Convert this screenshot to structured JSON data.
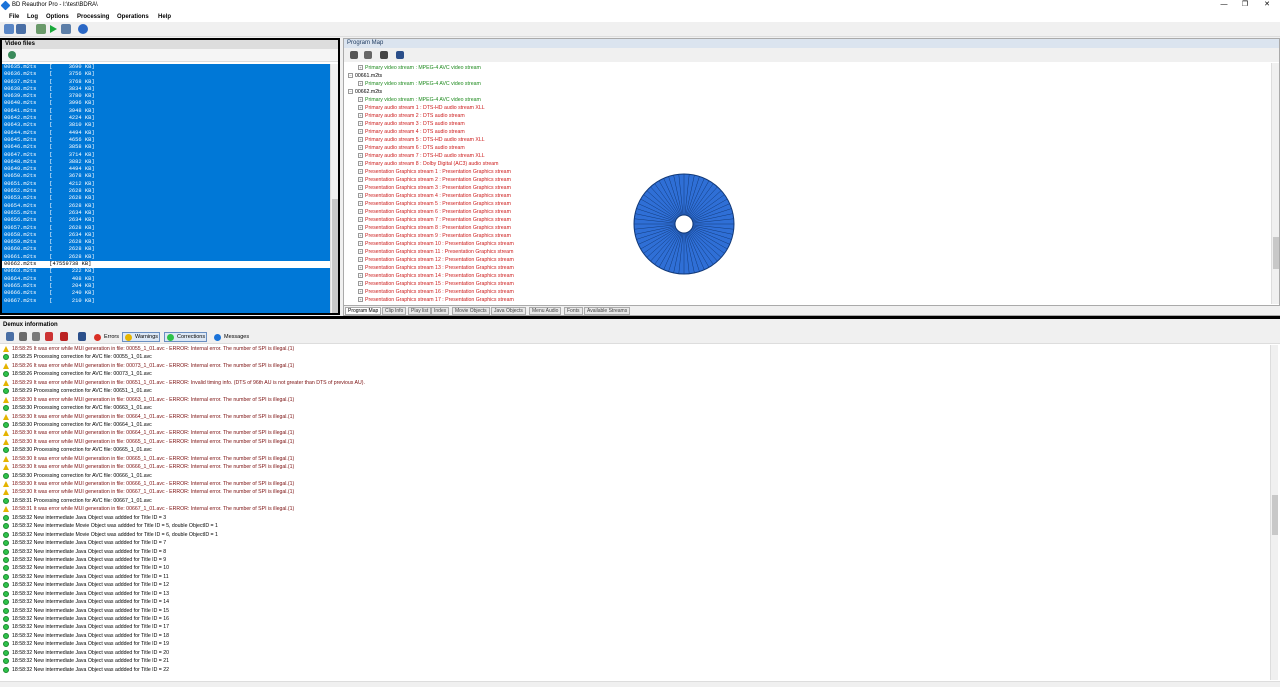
{
  "window": {
    "title": "BD Reauthor Pro - I:\\test\\BDRA\\",
    "min": "—",
    "max": "❐",
    "close": "✕"
  },
  "menu": [
    "File",
    "Log",
    "Options",
    "Processing",
    "Operations",
    "Help"
  ],
  "video_files": {
    "title": "Video files",
    "rows": [
      "00635.m2ts    [     3690 KB]",
      "00636.m2ts    [     3756 KB]",
      "00637.m2ts    [     3768 KB]",
      "00638.m2ts    [     3834 KB]",
      "00639.m2ts    [     3780 KB]",
      "00640.m2ts    [     3996 KB]",
      "00641.m2ts    [     3948 KB]",
      "00642.m2ts    [     4224 KB]",
      "00643.m2ts    [     3810 KB]",
      "00644.m2ts    [     4494 KB]",
      "00645.m2ts    [     4656 KB]",
      "00646.m2ts    [     3858 KB]",
      "00647.m2ts    [     3714 KB]",
      "00648.m2ts    [     3882 KB]",
      "00649.m2ts    [     4494 KB]",
      "00650.m2ts    [     3678 KB]",
      "00651.m2ts    [     4212 KB]",
      "00652.m2ts    [     2628 KB]",
      "00653.m2ts    [     2628 KB]",
      "00654.m2ts    [     2628 KB]",
      "00655.m2ts    [     2634 KB]",
      "00656.m2ts    [     2634 KB]",
      "00657.m2ts    [     2628 KB]",
      "00658.m2ts    [     2634 KB]",
      "00659.m2ts    [     2628 KB]",
      "00660.m2ts    [     2628 KB]",
      "00661.m2ts    [     2628 KB]",
      "00662.m2ts    [47559738 KB]",
      "00663.m2ts    [      222 KB]",
      "00664.m2ts    [      408 KB]",
      "00665.m2ts    [      204 KB]",
      "00666.m2ts    [      240 KB]",
      "00667.m2ts    [      210 KB]"
    ],
    "selected_index": 27
  },
  "program_map": {
    "title": "Program Map",
    "tree": [
      {
        "indent": 1,
        "text": "Primary video stream : MPEG-4 AVC video stream",
        "color": "green",
        "exp": "+"
      },
      {
        "indent": 0,
        "text": "00661.m2ts",
        "color": "black",
        "exp": "−"
      },
      {
        "indent": 1,
        "text": "Primary video stream : MPEG-4 AVC video stream",
        "color": "green",
        "exp": "+"
      },
      {
        "indent": 0,
        "text": "00662.m2ts",
        "color": "black",
        "exp": "−"
      },
      {
        "indent": 1,
        "text": "Primary video stream : MPEG-4 AVC video stream",
        "color": "green",
        "exp": "+"
      },
      {
        "indent": 1,
        "text": "Primary audio stream  1 : DTS-HD audio stream XLL",
        "color": "red",
        "exp": "+"
      },
      {
        "indent": 1,
        "text": "Primary audio stream  2 : DTS audio stream",
        "color": "red",
        "exp": "+"
      },
      {
        "indent": 1,
        "text": "Primary audio stream  3 : DTS audio stream",
        "color": "red",
        "exp": "+"
      },
      {
        "indent": 1,
        "text": "Primary audio stream  4 : DTS audio stream",
        "color": "red",
        "exp": "+"
      },
      {
        "indent": 1,
        "text": "Primary audio stream  5 : DTS-HD audio stream XLL",
        "color": "red",
        "exp": "+"
      },
      {
        "indent": 1,
        "text": "Primary audio stream  6 : DTS audio stream",
        "color": "red",
        "exp": "+"
      },
      {
        "indent": 1,
        "text": "Primary audio stream  7 : DTS-HD audio stream XLL",
        "color": "red",
        "exp": "+"
      },
      {
        "indent": 1,
        "text": "Primary audio stream  8 : Dolby Digital (AC3) audio stream",
        "color": "red",
        "exp": "+"
      },
      {
        "indent": 1,
        "text": "Presentation Graphics stream  1 : Presentation Graphics stream",
        "color": "red",
        "exp": "+"
      },
      {
        "indent": 1,
        "text": "Presentation Graphics stream  2 : Presentation Graphics stream",
        "color": "red",
        "exp": "+"
      },
      {
        "indent": 1,
        "text": "Presentation Graphics stream  3 : Presentation Graphics stream",
        "color": "red",
        "exp": "+"
      },
      {
        "indent": 1,
        "text": "Presentation Graphics stream  4 : Presentation Graphics stream",
        "color": "red",
        "exp": "+"
      },
      {
        "indent": 1,
        "text": "Presentation Graphics stream  5 : Presentation Graphics stream",
        "color": "red",
        "exp": "+"
      },
      {
        "indent": 1,
        "text": "Presentation Graphics stream  6 : Presentation Graphics stream",
        "color": "red",
        "exp": "+"
      },
      {
        "indent": 1,
        "text": "Presentation Graphics stream  7 : Presentation Graphics stream",
        "color": "red",
        "exp": "+"
      },
      {
        "indent": 1,
        "text": "Presentation Graphics stream  8 : Presentation Graphics stream",
        "color": "red",
        "exp": "+"
      },
      {
        "indent": 1,
        "text": "Presentation Graphics stream  9 : Presentation Graphics stream",
        "color": "red",
        "exp": "+"
      },
      {
        "indent": 1,
        "text": "Presentation Graphics stream  10 : Presentation Graphics stream",
        "color": "red",
        "exp": "+"
      },
      {
        "indent": 1,
        "text": "Presentation Graphics stream  11 : Presentation Graphics stream",
        "color": "red",
        "exp": "+"
      },
      {
        "indent": 1,
        "text": "Presentation Graphics stream  12 : Presentation Graphics stream",
        "color": "red",
        "exp": "+"
      },
      {
        "indent": 1,
        "text": "Presentation Graphics stream  13 : Presentation Graphics stream",
        "color": "red",
        "exp": "+"
      },
      {
        "indent": 1,
        "text": "Presentation Graphics stream  14 : Presentation Graphics stream",
        "color": "red",
        "exp": "+"
      },
      {
        "indent": 1,
        "text": "Presentation Graphics stream  15 : Presentation Graphics stream",
        "color": "red",
        "exp": "+"
      },
      {
        "indent": 1,
        "text": "Presentation Graphics stream  16 : Presentation Graphics stream",
        "color": "red",
        "exp": "+"
      },
      {
        "indent": 1,
        "text": "Presentation Graphics stream  17 : Presentation Graphics stream",
        "color": "red",
        "exp": "+"
      }
    ],
    "tabs": [
      "Program Map",
      "Clip Info",
      "Play list",
      "Index",
      "Movie Objects",
      "Java Objects",
      "Menu Audio",
      "Fonts",
      "Available Streams"
    ],
    "active_tab": 0,
    "busy_indicator": {
      "color": "#2f6fd6",
      "spokes": 60
    }
  },
  "demux": {
    "title": "Demux information",
    "filters": [
      {
        "label": "Errors",
        "icon": "error-icon",
        "color": "#d93025",
        "on": false
      },
      {
        "label": "Warnings",
        "icon": "warning-icon",
        "color": "#e5b400",
        "on": true
      },
      {
        "label": "Corrections",
        "icon": "correction-icon",
        "color": "#2ec24a",
        "on": true
      },
      {
        "label": "Messages",
        "icon": "info-icon",
        "color": "#1a73d9",
        "on": false
      }
    ],
    "log": [
      {
        "type": "warn",
        "text": "18:58:25 It was error while MUI generation in file: 00055_1_01.avc - ERROR: Internal error. The number of SPI is illegal.(1)"
      },
      {
        "type": "ok",
        "text": "18:58:25 Processing correction for AVC file: 00055_1_01.avc"
      },
      {
        "type": "warn",
        "text": "18:58:26 It was error while MUI generation in file: 00073_1_01.avc - ERROR: Internal error. The number of SPI is illegal.(1)"
      },
      {
        "type": "ok",
        "text": "18:58:26 Processing correction for AVC file: 00073_1_01.avc"
      },
      {
        "type": "warn",
        "text": "18:58:29 It was error while MUI generation in file: 00651_1_01.avc - ERROR: Invalid timing info. (DTS of 96th AU is not greater than DTS of previous AU)."
      },
      {
        "type": "ok",
        "text": "18:58:29 Processing correction for AVC file: 00651_1_01.avc"
      },
      {
        "type": "warn",
        "text": "18:58:30 It was error while MUI generation in file: 00663_1_01.avc - ERROR: Internal error. The number of SPI is illegal.(1)"
      },
      {
        "type": "ok",
        "text": "18:58:30 Processing correction for AVC file: 00663_1_01.avc"
      },
      {
        "type": "warn",
        "text": "18:58:30 It was error while MUI generation in file: 00664_1_01.avc - ERROR: Internal error. The number of SPI is illegal.(1)"
      },
      {
        "type": "ok",
        "text": "18:58:30 Processing correction for AVC file: 00664_1_01.avc"
      },
      {
        "type": "warn",
        "text": "18:58:30 It was error while MUI generation in file: 00664_1_01.avc - ERROR: Internal error. The number of SPI is illegal.(1)"
      },
      {
        "type": "warn",
        "text": "18:58:30 It was error while MUI generation in file: 00665_1_01.avc - ERROR: Internal error. The number of SPI is illegal.(1)"
      },
      {
        "type": "ok",
        "text": "18:58:30 Processing correction for AVC file: 00665_1_01.avc"
      },
      {
        "type": "warn",
        "text": "18:58:30 It was error while MUI generation in file: 00665_1_01.avc - ERROR: Internal error. The number of SPI is illegal.(1)"
      },
      {
        "type": "warn",
        "text": "18:58:30 It was error while MUI generation in file: 00666_1_01.avc - ERROR: Internal error. The number of SPI is illegal.(1)"
      },
      {
        "type": "ok",
        "text": "18:58:30 Processing correction for AVC file: 00666_1_01.avc"
      },
      {
        "type": "warn",
        "text": "18:58:30 It was error while MUI generation in file: 00666_1_01.avc - ERROR: Internal error. The number of SPI is illegal.(1)"
      },
      {
        "type": "warn",
        "text": "18:58:30 It was error while MUI generation in file: 00667_1_01.avc - ERROR: Internal error. The number of SPI is illegal.(1)"
      },
      {
        "type": "ok",
        "text": "18:58:31 Processing correction for AVC file: 00667_1_01.avc"
      },
      {
        "type": "warn",
        "text": "18:58:31 It was error while MUI generation in file: 00667_1_01.avc - ERROR: Internal error. The number of SPI is illegal.(1)"
      },
      {
        "type": "ok",
        "text": "18:58:32 New intermediate Java Object was addded for Title ID = 3"
      },
      {
        "type": "ok",
        "text": "18:58:32 New intermediate Movie Object was addded for Title ID = 5, double ObjectID = 1"
      },
      {
        "type": "ok",
        "text": "18:58:32 New intermediate Movie Object was addded for Title ID = 6, double ObjectID = 1"
      },
      {
        "type": "ok",
        "text": "18:58:32 New intermediate Java Object was addded for Title ID = 7"
      },
      {
        "type": "ok",
        "text": "18:58:32 New intermediate Java Object was addded for Title ID = 8"
      },
      {
        "type": "ok",
        "text": "18:58:32 New intermediate Java Object was addded for Title ID = 9"
      },
      {
        "type": "ok",
        "text": "18:58:32 New intermediate Java Object was addded for Title ID = 10"
      },
      {
        "type": "ok",
        "text": "18:58:32 New intermediate Java Object was addded for Title ID = 11"
      },
      {
        "type": "ok",
        "text": "18:58:32 New intermediate Java Object was addded for Title ID = 12"
      },
      {
        "type": "ok",
        "text": "18:58:32 New intermediate Java Object was addded for Title ID = 13"
      },
      {
        "type": "ok",
        "text": "18:58:32 New intermediate Java Object was addded for Title ID = 14"
      },
      {
        "type": "ok",
        "text": "18:58:32 New intermediate Java Object was addded for Title ID = 15"
      },
      {
        "type": "ok",
        "text": "18:58:32 New intermediate Java Object was addded for Title ID = 16"
      },
      {
        "type": "ok",
        "text": "18:58:32 New intermediate Java Object was addded for Title ID = 17"
      },
      {
        "type": "ok",
        "text": "18:58:32 New intermediate Java Object was addded for Title ID = 18"
      },
      {
        "type": "ok",
        "text": "18:58:32 New intermediate Java Object was addded for Title ID = 19"
      },
      {
        "type": "ok",
        "text": "18:58:32 New intermediate Java Object was addded for Title ID = 20"
      },
      {
        "type": "ok",
        "text": "18:58:32 New intermediate Java Object was addded for Title ID = 21"
      },
      {
        "type": "ok",
        "text": "18:58:32 New intermediate Java Object was addded for Title ID = 22"
      }
    ]
  }
}
